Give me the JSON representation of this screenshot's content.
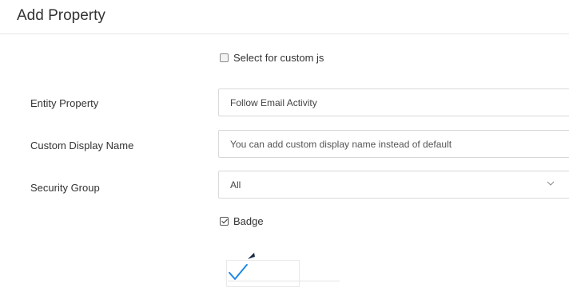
{
  "header": {
    "title": "Add Property"
  },
  "custom_js": {
    "label": "Select for custom js",
    "checked": false
  },
  "entity_property": {
    "label": "Entity Property",
    "value": "Follow Email Activity"
  },
  "custom_display_name": {
    "label": "Custom Display Name",
    "placeholder": "You can add custom display name instead of default"
  },
  "security_group": {
    "label": "Security Group",
    "selected": "All"
  },
  "badge": {
    "label": "Badge",
    "checked": true
  },
  "colors": {
    "accent_check": "#1e88e5",
    "border": "#d9d9d9"
  },
  "icons": {
    "chevron": "chevron-down-icon",
    "check": "check-icon",
    "cursor": "cursor-arrow-icon"
  }
}
